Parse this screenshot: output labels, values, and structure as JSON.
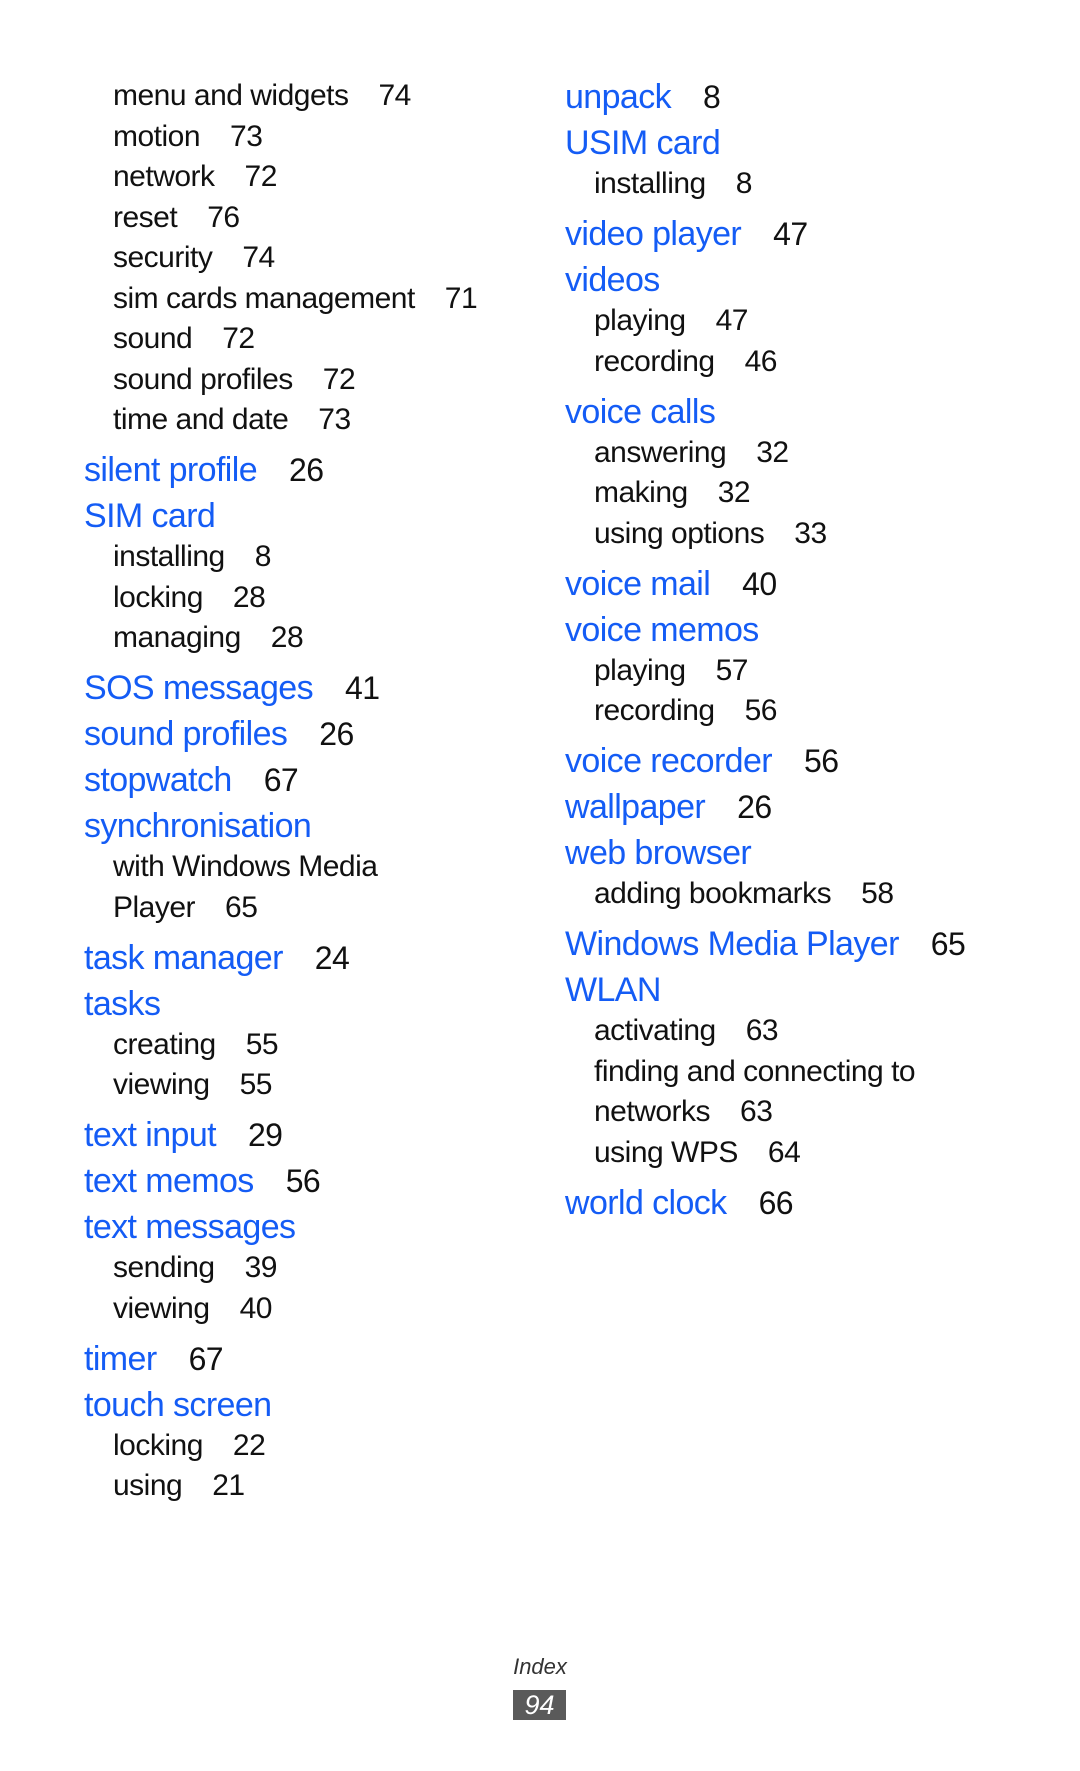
{
  "index": {
    "left_column": [
      {
        "type": "sub",
        "text": "menu and widgets",
        "page": "74"
      },
      {
        "type": "sub",
        "text": "motion",
        "page": "73"
      },
      {
        "type": "sub",
        "text": "network",
        "page": "72"
      },
      {
        "type": "sub",
        "text": "reset",
        "page": "76"
      },
      {
        "type": "sub",
        "text": "security",
        "page": "74"
      },
      {
        "type": "sub",
        "text": "sim cards management",
        "page": "71"
      },
      {
        "type": "sub",
        "text": "sound",
        "page": "72"
      },
      {
        "type": "sub",
        "text": "sound profiles",
        "page": "72"
      },
      {
        "type": "sub",
        "text": "time and date",
        "page": "73"
      },
      {
        "type": "head",
        "text": "silent profile",
        "page": "26"
      },
      {
        "type": "head",
        "text": "SIM card",
        "page": ""
      },
      {
        "type": "sub",
        "text": "installing",
        "page": "8"
      },
      {
        "type": "sub",
        "text": "locking",
        "page": "28"
      },
      {
        "type": "sub",
        "text": "managing",
        "page": "28"
      },
      {
        "type": "head",
        "text": "SOS messages",
        "page": "41"
      },
      {
        "type": "head",
        "text": "sound profiles",
        "page": "26"
      },
      {
        "type": "head",
        "text": "stopwatch",
        "page": "67"
      },
      {
        "type": "head",
        "text": "synchronisation",
        "page": ""
      },
      {
        "type": "sub",
        "text": "with Windows Media",
        "page": ""
      },
      {
        "type": "sub",
        "text": "Player",
        "page": "65"
      },
      {
        "type": "head",
        "text": "task manager",
        "page": "24"
      },
      {
        "type": "head",
        "text": "tasks",
        "page": ""
      },
      {
        "type": "sub",
        "text": "creating",
        "page": "55"
      },
      {
        "type": "sub",
        "text": "viewing",
        "page": "55"
      },
      {
        "type": "head",
        "text": "text input",
        "page": "29"
      },
      {
        "type": "head",
        "text": "text memos",
        "page": "56"
      },
      {
        "type": "head",
        "text": "text messages",
        "page": ""
      },
      {
        "type": "sub",
        "text": "sending",
        "page": "39"
      },
      {
        "type": "sub",
        "text": "viewing",
        "page": "40"
      },
      {
        "type": "head",
        "text": "timer",
        "page": "67"
      },
      {
        "type": "head",
        "text": "touch screen",
        "page": ""
      },
      {
        "type": "sub",
        "text": "locking",
        "page": "22"
      },
      {
        "type": "sub",
        "text": "using",
        "page": "21"
      }
    ],
    "right_column": [
      {
        "type": "head",
        "text": "unpack",
        "page": "8"
      },
      {
        "type": "head",
        "text": "USIM card",
        "page": ""
      },
      {
        "type": "sub",
        "text": "installing",
        "page": "8"
      },
      {
        "type": "head",
        "text": "video player",
        "page": "47"
      },
      {
        "type": "head",
        "text": "videos",
        "page": ""
      },
      {
        "type": "sub",
        "text": "playing",
        "page": "47"
      },
      {
        "type": "sub",
        "text": "recording",
        "page": "46"
      },
      {
        "type": "head",
        "text": "voice calls",
        "page": ""
      },
      {
        "type": "sub",
        "text": "answering",
        "page": "32"
      },
      {
        "type": "sub",
        "text": "making",
        "page": "32"
      },
      {
        "type": "sub",
        "text": "using options",
        "page": "33"
      },
      {
        "type": "head",
        "text": "voice mail",
        "page": "40"
      },
      {
        "type": "head",
        "text": "voice memos",
        "page": ""
      },
      {
        "type": "sub",
        "text": "playing",
        "page": "57"
      },
      {
        "type": "sub",
        "text": "recording",
        "page": "56"
      },
      {
        "type": "head",
        "text": "voice recorder",
        "page": "56"
      },
      {
        "type": "head",
        "text": "wallpaper",
        "page": "26"
      },
      {
        "type": "head",
        "text": "web browser",
        "page": ""
      },
      {
        "type": "sub",
        "text": "adding bookmarks",
        "page": "58"
      },
      {
        "type": "head",
        "text": "Windows Media Player",
        "page": "65"
      },
      {
        "type": "head",
        "text": "WLAN",
        "page": ""
      },
      {
        "type": "sub",
        "text": "activating",
        "page": "63"
      },
      {
        "type": "sub",
        "text": "finding and connecting to",
        "page": ""
      },
      {
        "type": "sub",
        "text": "networks",
        "page": "63"
      },
      {
        "type": "sub",
        "text": "using WPS",
        "page": "64"
      },
      {
        "type": "head",
        "text": "world clock",
        "page": "66"
      }
    ]
  },
  "footer": {
    "section_label": "Index",
    "page_number": "94"
  },
  "colors": {
    "headword": "#145cf5",
    "text": "#111111",
    "page_box": "#5a5a5a"
  }
}
